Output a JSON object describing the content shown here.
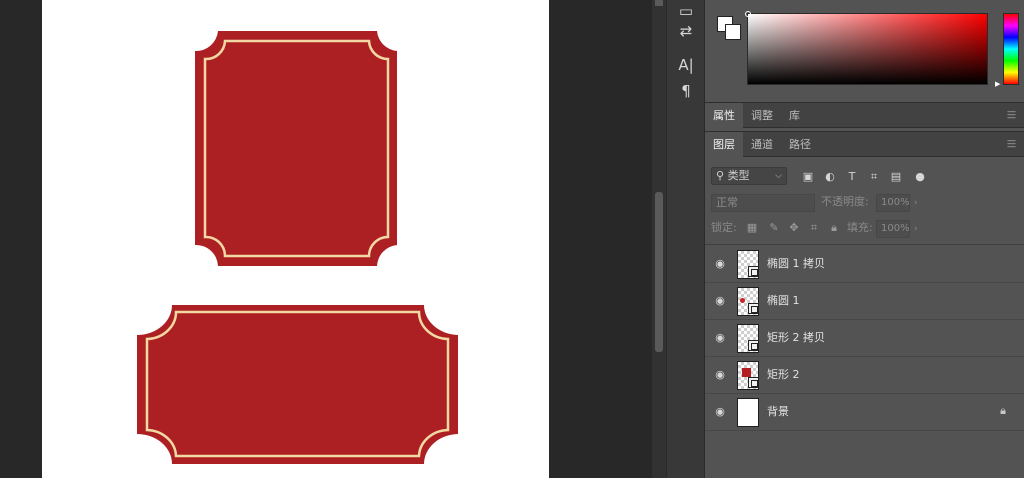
{
  "tools": {
    "icons": [
      "comment-icon",
      "history-icon",
      "character-icon",
      "paragraph-icon"
    ],
    "character_glyph": "A|",
    "paragraph_glyph": "¶"
  },
  "tabs_top": [
    "属性",
    "调整",
    "库"
  ],
  "tabs_layers": [
    "图层",
    "通道",
    "路径"
  ],
  "filter": {
    "kind_label": "类型",
    "icons": [
      "image-filter-icon",
      "adjustment-filter-icon",
      "type-filter-icon",
      "shape-filter-icon",
      "smart-object-filter-icon",
      "filter-toggle-icon"
    ]
  },
  "blend": {
    "mode": "正常",
    "opacity_label": "不透明度:",
    "opacity_value": "100%"
  },
  "lock": {
    "label": "锁定:",
    "fill_label": "填充:",
    "fill_value": "100%"
  },
  "layers": [
    {
      "name": "椭圆 1 拷贝",
      "thumb": "transparent-shape"
    },
    {
      "name": "椭圆 1",
      "thumb": "transparent-shape-red-dot"
    },
    {
      "name": "矩形 2 拷贝",
      "thumb": "transparent-shape"
    },
    {
      "name": "矩形 2",
      "thumb": "transparent-shape-red"
    },
    {
      "name": "背景",
      "thumb": "white",
      "locked": true
    }
  ],
  "colors": {
    "frame_red": "#ac2023",
    "frame_line": "#f2d9a4",
    "canvas": "#ffffff",
    "foreground": "#ffffff",
    "background": "#ffffff"
  }
}
